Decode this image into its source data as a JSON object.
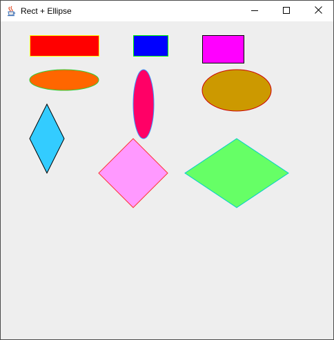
{
  "window": {
    "title": "Rect + Ellipse",
    "icon": "java-coffee-cup-icon",
    "controls": [
      "minimize-icon",
      "maximize-icon",
      "close-icon"
    ]
  },
  "canvas": {
    "background": "#eeeeee",
    "shapes": [
      {
        "name": "red-rectangle",
        "type": "rect",
        "fill": "#ff0000",
        "stroke": "#ffff00"
      },
      {
        "name": "blue-rectangle",
        "type": "rect",
        "fill": "#0000ff",
        "stroke": "#00ff00"
      },
      {
        "name": "magenta-rectangle",
        "type": "rect",
        "fill": "#ff00ff",
        "stroke": "#000000"
      },
      {
        "name": "orange-ellipse",
        "type": "ellipse",
        "fill": "#ff6600",
        "stroke": "#33cc33"
      },
      {
        "name": "pink-red-ellipse",
        "type": "ellipse",
        "fill": "#ff0066",
        "stroke": "#3399ff"
      },
      {
        "name": "gold-ellipse",
        "type": "ellipse",
        "fill": "#cc9900",
        "stroke": "#cc0000"
      },
      {
        "name": "cyan-diamond",
        "type": "diamond",
        "fill": "#33ccff",
        "stroke": "#000000"
      },
      {
        "name": "pink-diamond",
        "type": "diamond",
        "fill": "#ff99ff",
        "stroke": "#ff3333"
      },
      {
        "name": "green-diamond",
        "type": "diamond",
        "fill": "#66ff66",
        "stroke": "#00cccc"
      }
    ]
  }
}
